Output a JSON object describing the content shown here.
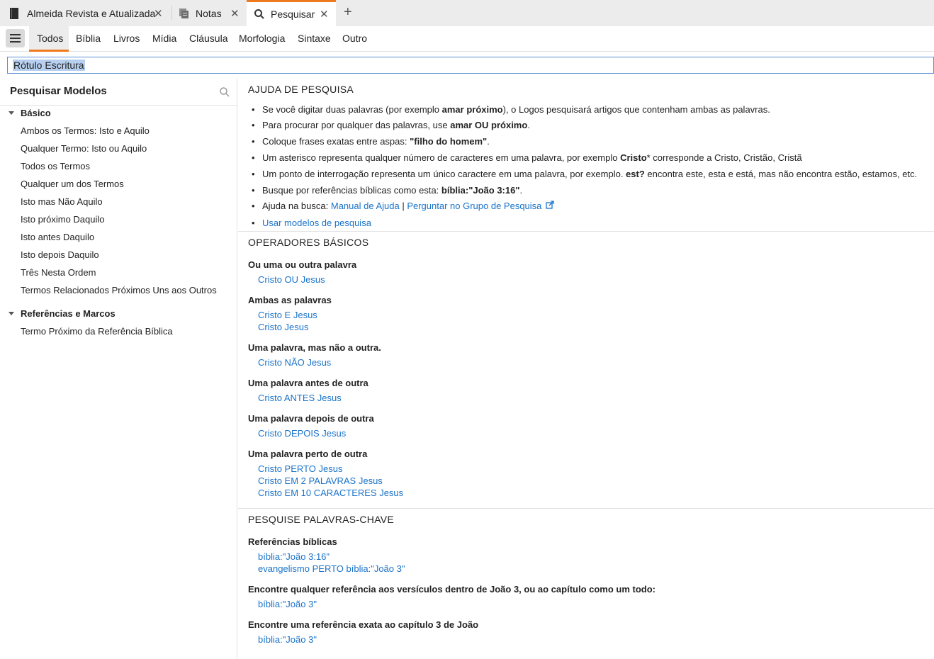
{
  "tabs": [
    {
      "label": "Almeida Revista e Atualizada",
      "icon": "book-icon"
    },
    {
      "label": "Notas",
      "icon": "notes-icon"
    },
    {
      "label": "Pesquisar",
      "icon": "search-icon"
    }
  ],
  "search_kinds": [
    "Todos",
    "Bíblia",
    "Livros",
    "Mídia",
    "Cláusula",
    "Morfologia",
    "Sintaxe",
    "Outro"
  ],
  "search_input": {
    "value": "Rótulo Escritura"
  },
  "left": {
    "title": "Pesquisar Modelos",
    "groups": [
      {
        "label": "Básico",
        "items": [
          "Ambos os Termos: Isto e Aquilo",
          "Qualquer Termo: Isto ou Aquilo",
          "Todos os Termos",
          "Qualquer um dos Termos",
          "Isto mas Não Aquilo",
          "Isto próximo Daquilo",
          "Isto antes Daquilo",
          "Isto depois Daquilo",
          "Três Nesta Ordem",
          "Termos Relacionados Próximos Uns aos Outros"
        ]
      },
      {
        "label": "Referências e Marcos",
        "items": [
          "Termo Próximo da Referência Bíblica"
        ]
      }
    ]
  },
  "help": {
    "title": "AJUDA DE PESQUISA",
    "b1": {
      "a": "Se você digitar duas palavras (por exemplo ",
      "b": "amar próximo",
      "c": "), o Logos pesquisará artigos que contenham ambas as palavras."
    },
    "b2": {
      "a": "Para procurar por qualquer das palavras, use ",
      "b": "amar OU próximo",
      "c": "."
    },
    "b3": {
      "a": "Coloque frases exatas entre aspas: ",
      "b": "\"filho do homem\"",
      "c": "."
    },
    "b4": {
      "a": "Um asterisco representa qualquer número de caracteres em uma palavra, por exemplo ",
      "b": "Cristo",
      "c": "* corresponde a Cristo, Cristão, Cristã"
    },
    "b5": {
      "a": "Um ponto de interrogação representa um único caractere em uma palavra, por exemplo. ",
      "b": "est?",
      "c": " encontra este, esta e está, mas não encontra estão, estamos, etc."
    },
    "b6": {
      "a": "Busque por referências bíblicas como esta: ",
      "b": "bíblia:\"João 3:16\"",
      "c": "."
    },
    "b7": {
      "a": "Ajuda na busca: ",
      "link1": "Manual de Ajuda",
      "sep": " | ",
      "link2": "Perguntar no Grupo de Pesquisa"
    },
    "b8": {
      "link": "Usar modelos de pesquisa"
    }
  },
  "operators": {
    "title": "OPERADORES BÁSICOS",
    "groups": [
      {
        "label": "Ou uma ou outra palavra",
        "examples": [
          "Cristo OU Jesus"
        ]
      },
      {
        "label": "Ambas as palavras",
        "examples": [
          "Cristo E Jesus",
          "Cristo Jesus"
        ]
      },
      {
        "label": "Uma palavra, mas não a outra.",
        "examples": [
          "Cristo NÃO Jesus"
        ]
      },
      {
        "label": "Uma palavra antes de outra",
        "examples": [
          "Cristo ANTES Jesus"
        ]
      },
      {
        "label": "Uma palavra depois de outra",
        "examples": [
          "Cristo DEPOIS Jesus"
        ]
      },
      {
        "label": "Uma palavra perto de outra",
        "examples": [
          "Cristo PERTO Jesus",
          "Cristo EM 2 PALAVRAS Jesus",
          "Cristo EM 10 CARACTERES Jesus"
        ]
      }
    ]
  },
  "keywords": {
    "title": "PESQUISE PALAVRAS-CHAVE",
    "groups": [
      {
        "label": "Referências bíblicas",
        "examples": [
          "bíblia:\"João 3:16\"",
          "evangelismo PERTO bíblia:\"João 3\""
        ]
      },
      {
        "label": "Encontre qualquer referência aos versículos dentro de João 3, ou ao capítulo como um todo:",
        "examples": [
          "bíblia:\"João 3\""
        ]
      },
      {
        "label": "Encontre uma referência exata ao capítulo 3 de João",
        "examples": [
          "bíblia:\"João 3\""
        ]
      }
    ]
  },
  "colors": {
    "accent": "#ef7a1e",
    "link": "#1a73c8"
  }
}
